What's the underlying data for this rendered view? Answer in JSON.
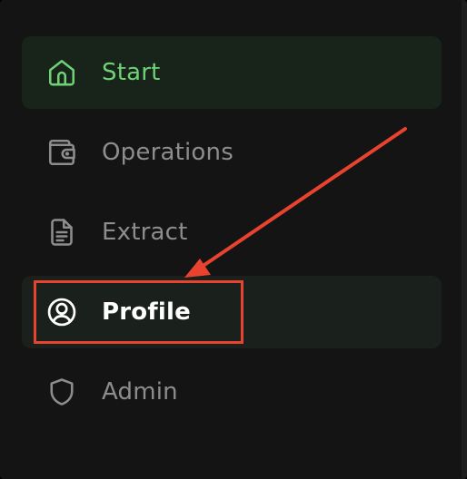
{
  "sidebar": {
    "items": [
      {
        "label": "Start",
        "icon": "home-icon",
        "state": "active"
      },
      {
        "label": "Operations",
        "icon": "wallet-icon",
        "state": "default"
      },
      {
        "label": "Extract",
        "icon": "document-icon",
        "state": "default"
      },
      {
        "label": "Profile",
        "icon": "user-circle-icon",
        "state": "hover"
      },
      {
        "label": "Admin",
        "icon": "shield-icon",
        "state": "default"
      }
    ]
  },
  "colors": {
    "background": "#141414",
    "active_text": "#6fd176",
    "active_bg": "#18231a",
    "default_text": "#8d8d8d",
    "hover_text": "#ffffff",
    "annotation": "#e8432e"
  }
}
